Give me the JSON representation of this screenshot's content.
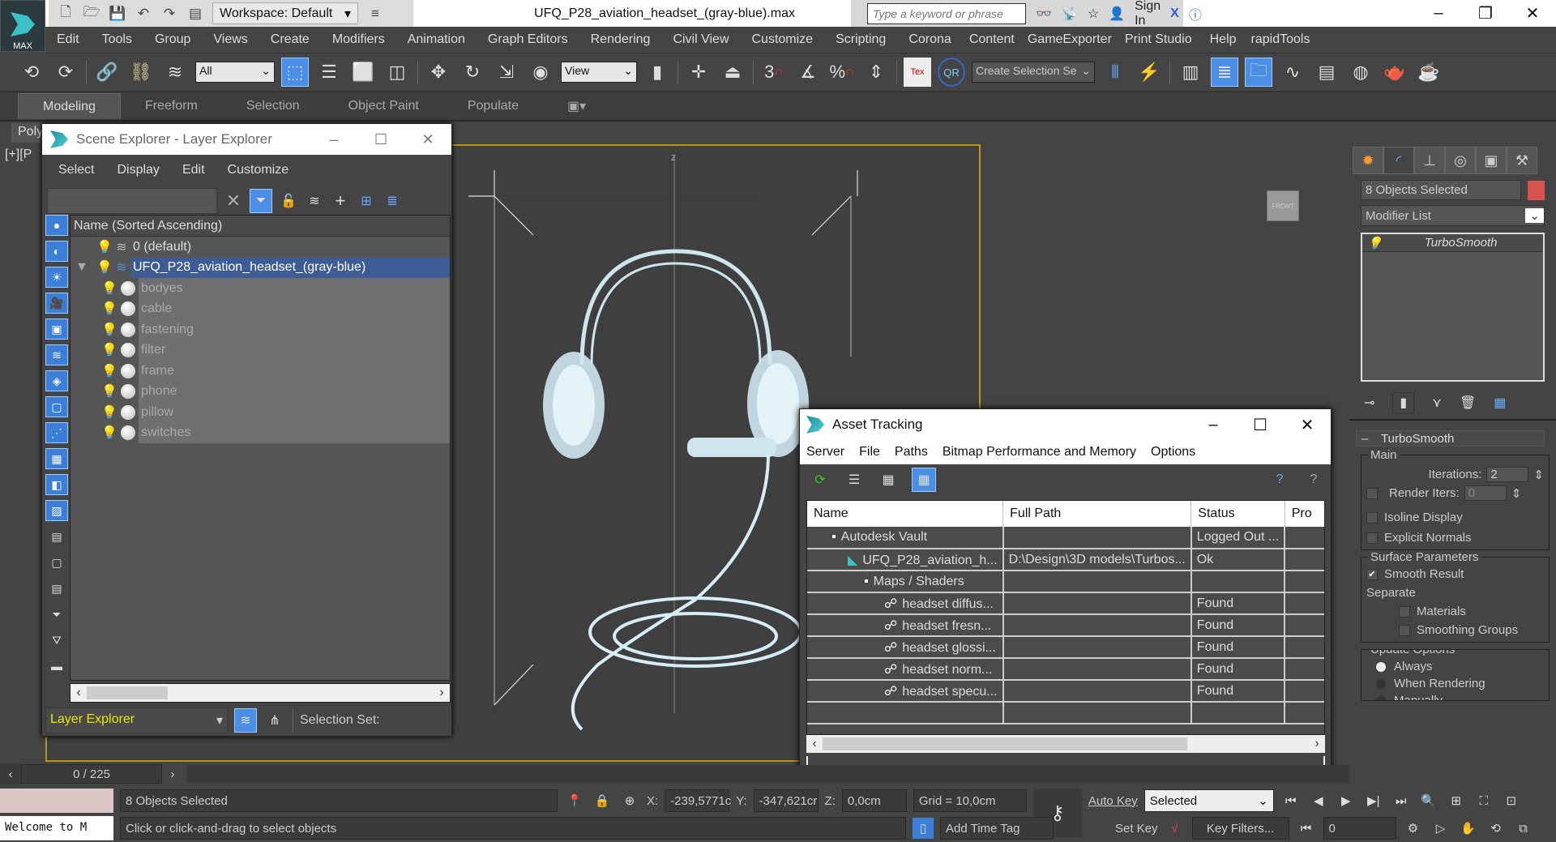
{
  "app": {
    "logo_label": "MAX",
    "title": "UFQ_P28_aviation_headset_(gray-blue).max",
    "workspace": "Workspace: Default",
    "search_placeholder": "Type a keyword or phrase",
    "sign_in": "Sign In"
  },
  "menu": [
    "Edit",
    "Tools",
    "Group",
    "Views",
    "Create",
    "Modifiers",
    "Animation",
    "Graph Editors",
    "Rendering",
    "Civil View",
    "Customize",
    "Scripting",
    "Corona",
    "Content",
    "GameExporter",
    "Print Studio",
    "Help",
    "rapidTools"
  ],
  "toolbar": {
    "filter": "All",
    "ref_coord": "View",
    "selection_set": "Create Selection Se",
    "snap_3": "3",
    "snap_pct": "%"
  },
  "ribbon": {
    "tabs": [
      "Modeling",
      "Freeform",
      "Selection",
      "Object Paint",
      "Populate"
    ],
    "panel": "Poly"
  },
  "viewport": {
    "label": "[+][P",
    "cube": "FRONT",
    "axis": "z"
  },
  "scene_explorer": {
    "title": "Scene Explorer - Layer Explorer",
    "menu": [
      "Select",
      "Display",
      "Edit",
      "Customize"
    ],
    "column": "Name (Sorted Ascending)",
    "layers": [
      {
        "name": "0 (default)"
      },
      {
        "name": "UFQ_P28_aviation_headset_(gray-blue)"
      }
    ],
    "objects": [
      "bodyes",
      "cable",
      "fastening",
      "filter",
      "frame",
      "phone",
      "pillow",
      "switches"
    ],
    "explorer_type": "Layer Explorer",
    "selection_set": "Selection Set:"
  },
  "asset_tracking": {
    "title": "Asset Tracking",
    "menu": [
      "Server",
      "File",
      "Paths",
      "Bitmap Performance and Memory",
      "Options"
    ],
    "columns": [
      "Name",
      "Full Path",
      "Status",
      "Pro"
    ],
    "rows": [
      {
        "name": "Autodesk Vault",
        "path": "",
        "status": "Logged Out ..."
      },
      {
        "name": "UFQ_P28_aviation_h...",
        "path": "D:\\Design\\3D models\\Turbos...",
        "status": "Ok"
      },
      {
        "name": "Maps / Shaders",
        "path": "",
        "status": ""
      },
      {
        "name": "headset diffus...",
        "path": "",
        "status": "Found"
      },
      {
        "name": "headset fresn...",
        "path": "",
        "status": "Found"
      },
      {
        "name": "headset glossi...",
        "path": "",
        "status": "Found"
      },
      {
        "name": "headset norm...",
        "path": "",
        "status": "Found"
      },
      {
        "name": "headset specu...",
        "path": "",
        "status": "Found"
      }
    ]
  },
  "command_panel": {
    "selection": "8 Objects Selected",
    "color": "#d9534f",
    "modifier_list": "Modifier List",
    "stack": [
      "TurboSmooth"
    ],
    "rollout": "TurboSmooth",
    "main": {
      "title": "Main",
      "iterations_label": "Iterations:",
      "iterations": "2",
      "render_iters_label": "Render Iters:",
      "render_iters": "0",
      "isoline": "Isoline Display",
      "explicit": "Explicit Normals"
    },
    "surface": {
      "title": "Surface Parameters",
      "smooth": "Smooth Result",
      "separate": "Separate",
      "materials": "Materials",
      "smoothing_groups": "Smoothing Groups"
    },
    "update": {
      "title": "Update Options",
      "always": "Always",
      "when_rendering": "When Rendering",
      "manually": "Manually"
    }
  },
  "status": {
    "frame": "0 / 225",
    "listener": "Welcome to M",
    "selected": "8 Objects Selected",
    "prompt": "Click or click-and-drag to select objects",
    "x_label": "X:",
    "x": "-239,5771c",
    "y_label": "Y:",
    "y": "-347,621cr",
    "z_label": "Z:",
    "z": "0,0cm",
    "grid": "Grid = 10,0cm",
    "auto_key": "Auto Key",
    "set_key": "Set Key",
    "key_mode": "Selected",
    "key_filters": "Key Filters...",
    "add_time_tag": "Add Time Tag",
    "current_frame": "0"
  }
}
